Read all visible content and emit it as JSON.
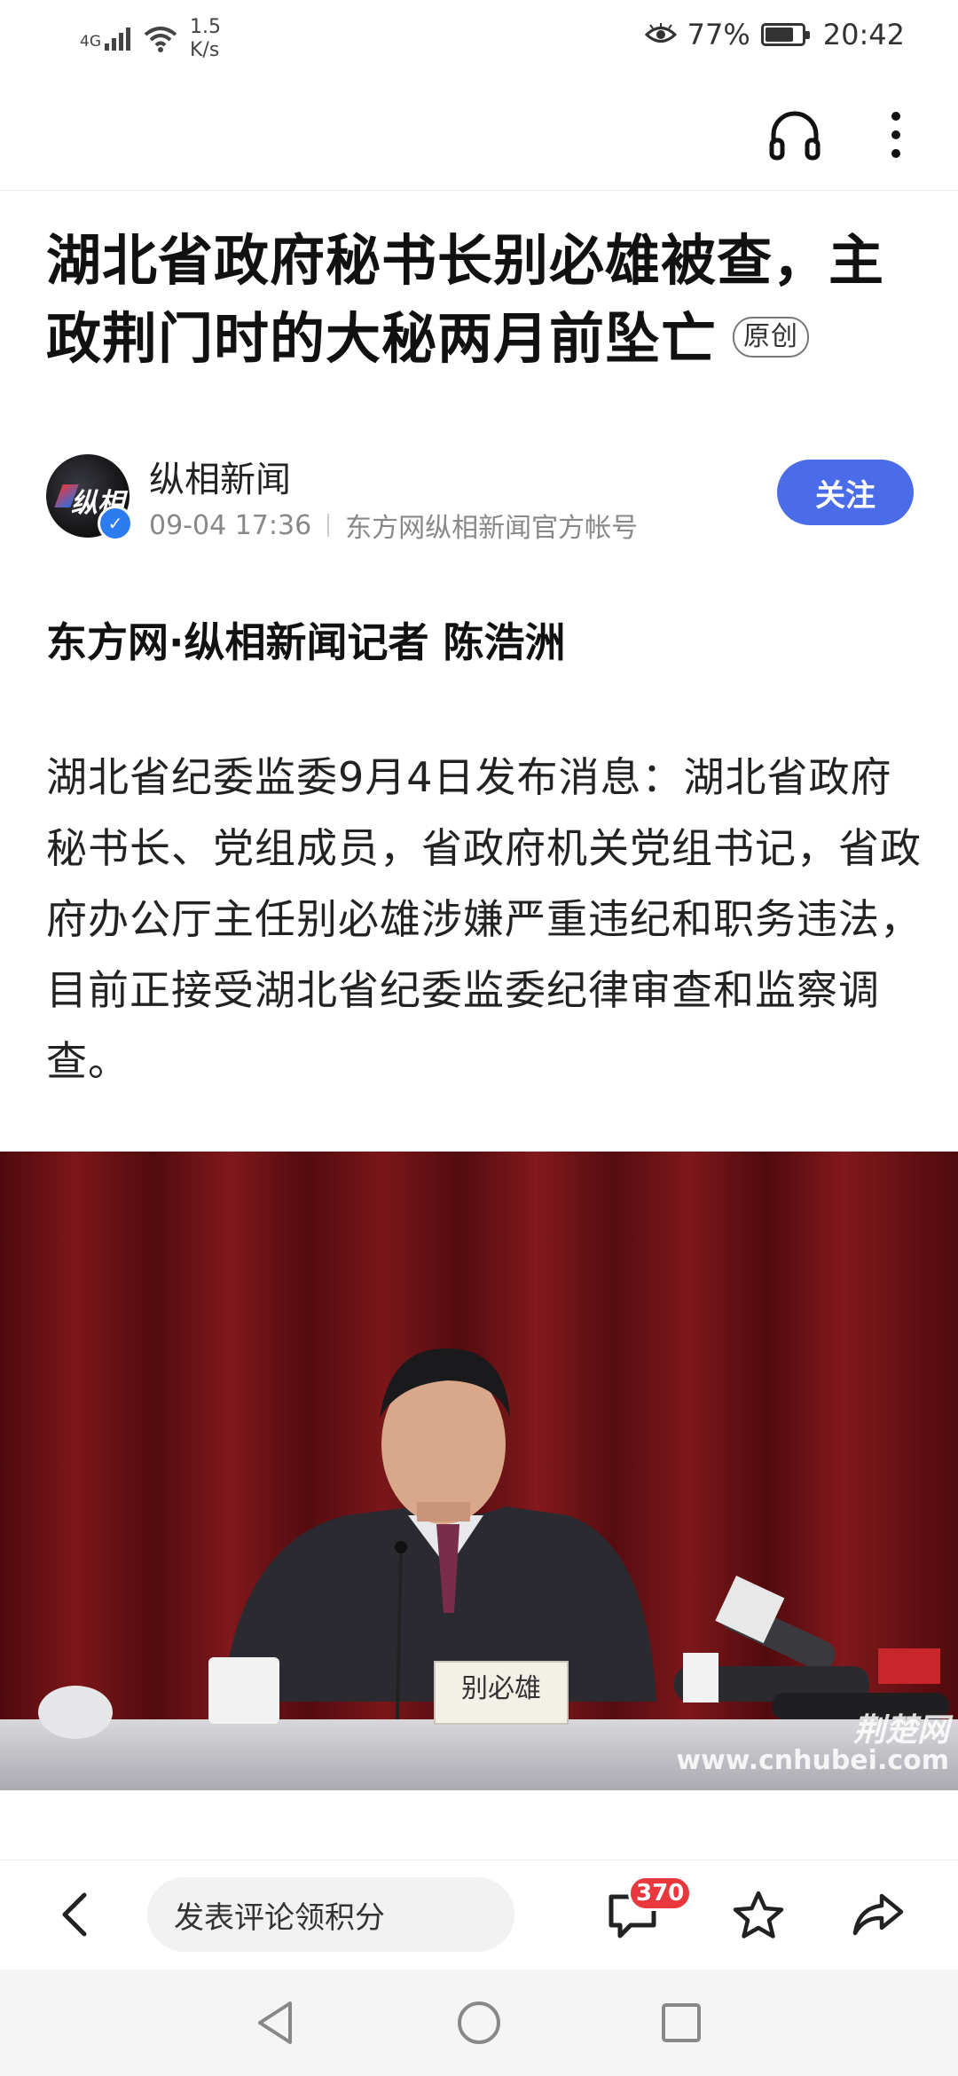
{
  "status_bar": {
    "network": "4G",
    "speed_value": "1.5",
    "speed_unit": "K/s",
    "battery": "77%",
    "battery_level": 0.77,
    "time": "20:42"
  },
  "top_bar": {
    "icons": [
      "headphones-icon",
      "more-vertical-icon"
    ]
  },
  "article": {
    "title": "湖北省政府秘书长别必雄被查，主政荆门时的大秘两月前坠亡",
    "badge": "原创",
    "author": {
      "name": "纵相新闻",
      "avatar_text": "纵相",
      "date": "09-04 17:36",
      "account": "东方网纵相新闻官方帐号",
      "follow_label": "关注"
    },
    "byline": "东方网·纵相新闻记者 陈浩洲",
    "paragraph": "湖北省纪委监委9月4日发布消息：湖北省政府秘书长、党组成员，省政府机关党组书记，省政府办公厅主任别必雄涉嫌严重违纪和职务违法，目前正接受湖北省纪委监委纪律审查和监察调查。",
    "photo": {
      "nameplate": "别必雄",
      "watermark_logo": "荆楚网",
      "watermark_url": "www.cnhubei.com"
    }
  },
  "bottom_bar": {
    "comment_placeholder": "发表评论领积分",
    "comment_count": "370"
  },
  "colors": {
    "accent": "#4a6ce8",
    "badge_red": "#e8383d",
    "verify_blue": "#2c7cf0"
  }
}
